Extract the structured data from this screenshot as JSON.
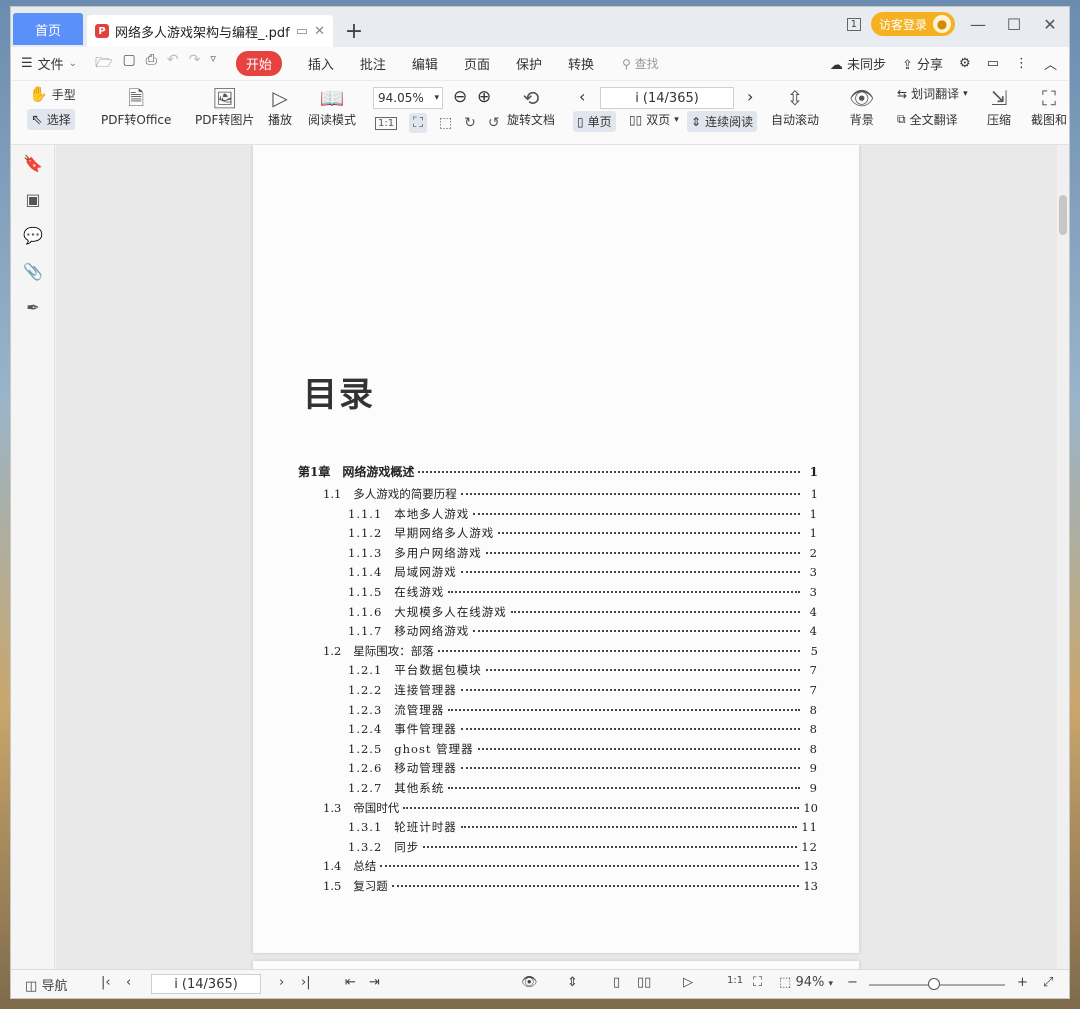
{
  "titlebar": {
    "home_tab": "首页",
    "doc_tab": "网络多人游戏架构与编程_.pdf",
    "new_tab": "+",
    "page_indicator_icon": "1",
    "login": "访客登录"
  },
  "menubar": {
    "file": "文件",
    "items": [
      "开始",
      "插入",
      "批注",
      "编辑",
      "页面",
      "保护",
      "转换"
    ],
    "active": "开始",
    "search": "查找",
    "sync": "未同步",
    "share": "分享"
  },
  "toolbar": {
    "hand": "手型",
    "select": "选择",
    "pdf_to_office": "PDF转Office",
    "pdf_to_image": "PDF转图片",
    "play": "播放",
    "read_mode": "阅读模式",
    "zoom": "94.05%",
    "rotate_doc": "旋转文档",
    "page_display": "i (14/365)",
    "single": "单页",
    "double": "双页",
    "continuous": "连续阅读",
    "auto_scroll": "自动滚动",
    "background": "背景",
    "word_translate": "划词翻译",
    "full_translate": "全文翻译",
    "compress": "压缩",
    "screenshot": "截图和"
  },
  "document": {
    "heading": "目录",
    "toc": [
      {
        "level": 0,
        "num": "第1章",
        "title": "网络游戏概述",
        "page": "1"
      },
      {
        "level": 1,
        "num": "1.1",
        "title": "多人游戏的简要历程",
        "page": "1"
      },
      {
        "level": 2,
        "num": "1.1.1",
        "title": "本地多人游戏",
        "page": "1"
      },
      {
        "level": 2,
        "num": "1.1.2",
        "title": "早期网络多人游戏",
        "page": "1"
      },
      {
        "level": 2,
        "num": "1.1.3",
        "title": "多用户网络游戏",
        "page": "2"
      },
      {
        "level": 2,
        "num": "1.1.4",
        "title": "局域网游戏",
        "page": "3"
      },
      {
        "level": 2,
        "num": "1.1.5",
        "title": "在线游戏",
        "page": "3"
      },
      {
        "level": 2,
        "num": "1.1.6",
        "title": "大规模多人在线游戏",
        "page": "4"
      },
      {
        "level": 2,
        "num": "1.1.7",
        "title": "移动网络游戏",
        "page": "4"
      },
      {
        "level": 1,
        "num": "1.2",
        "title": "星际围攻：部落",
        "page": "5"
      },
      {
        "level": 2,
        "num": "1.2.1",
        "title": "平台数据包模块",
        "page": "7"
      },
      {
        "level": 2,
        "num": "1.2.2",
        "title": "连接管理器",
        "page": "7"
      },
      {
        "level": 2,
        "num": "1.2.3",
        "title": "流管理器",
        "page": "8"
      },
      {
        "level": 2,
        "num": "1.2.4",
        "title": "事件管理器",
        "page": "8"
      },
      {
        "level": 2,
        "num": "1.2.5",
        "title": "ghost 管理器",
        "page": "8"
      },
      {
        "level": 2,
        "num": "1.2.6",
        "title": "移动管理器",
        "page": "9"
      },
      {
        "level": 2,
        "num": "1.2.7",
        "title": "其他系统",
        "page": "9"
      },
      {
        "level": 1,
        "num": "1.3",
        "title": "帝国时代",
        "page": "10"
      },
      {
        "level": 2,
        "num": "1.3.1",
        "title": "轮班计时器",
        "page": "11"
      },
      {
        "level": 2,
        "num": "1.3.2",
        "title": "同步",
        "page": "12"
      },
      {
        "level": 1,
        "num": "1.4",
        "title": "总结",
        "page": "13"
      },
      {
        "level": 1,
        "num": "1.5",
        "title": "复习题",
        "page": "13"
      }
    ]
  },
  "statusbar": {
    "nav": "导航",
    "page_display": "i (14/365)",
    "zoom": "94%",
    "zoom_level": 0.45
  }
}
